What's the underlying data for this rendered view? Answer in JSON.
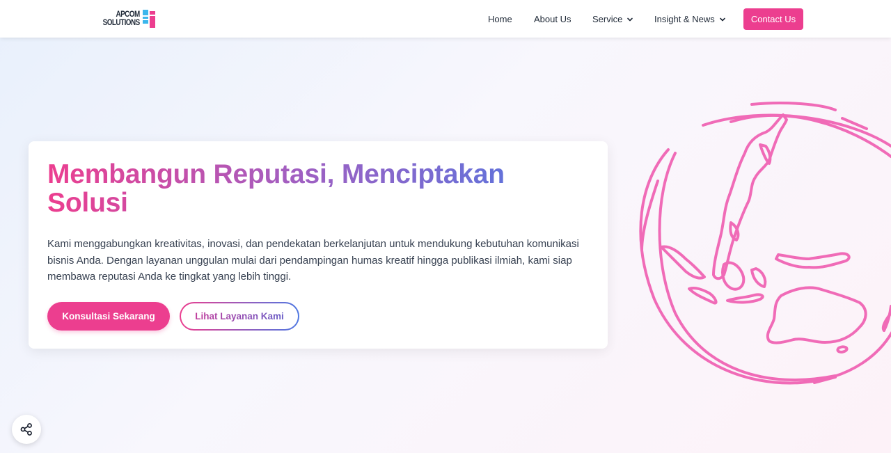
{
  "brand": {
    "logo_line1": "APCOM",
    "logo_line2": "SOLUTIONS",
    "primary_color": "#ec3e8f",
    "accent_color": "#4f78e2"
  },
  "nav": {
    "home": "Home",
    "about": "About Us",
    "service": "Service",
    "insight": "Insight & News",
    "contact": "Contact Us"
  },
  "hero": {
    "title_line1": "Membangun Reputasi, Menciptakan",
    "title_line2": "Solusi",
    "description": "Kami menggabungkan kreativitas, inovasi, dan pendekatan berkelanjutan untuk mendukung kebutuhan komunikasi bisnis Anda. Dengan layanan unggulan mulai dari pendampingan humas kreatif hingga publikasi ilmiah, kami siap membawa reputasi Anda ke tingkat yang lebih tinggi.",
    "primary_button": "Konsultasi Sekarang",
    "secondary_button": "Lihat Layanan Kami"
  },
  "icons": {
    "logo": "apcom-logo-mark",
    "service_dropdown": "chevron-down-icon",
    "insight_dropdown": "chevron-down-icon",
    "globe": "globe-illustration",
    "share": "share-icon"
  }
}
